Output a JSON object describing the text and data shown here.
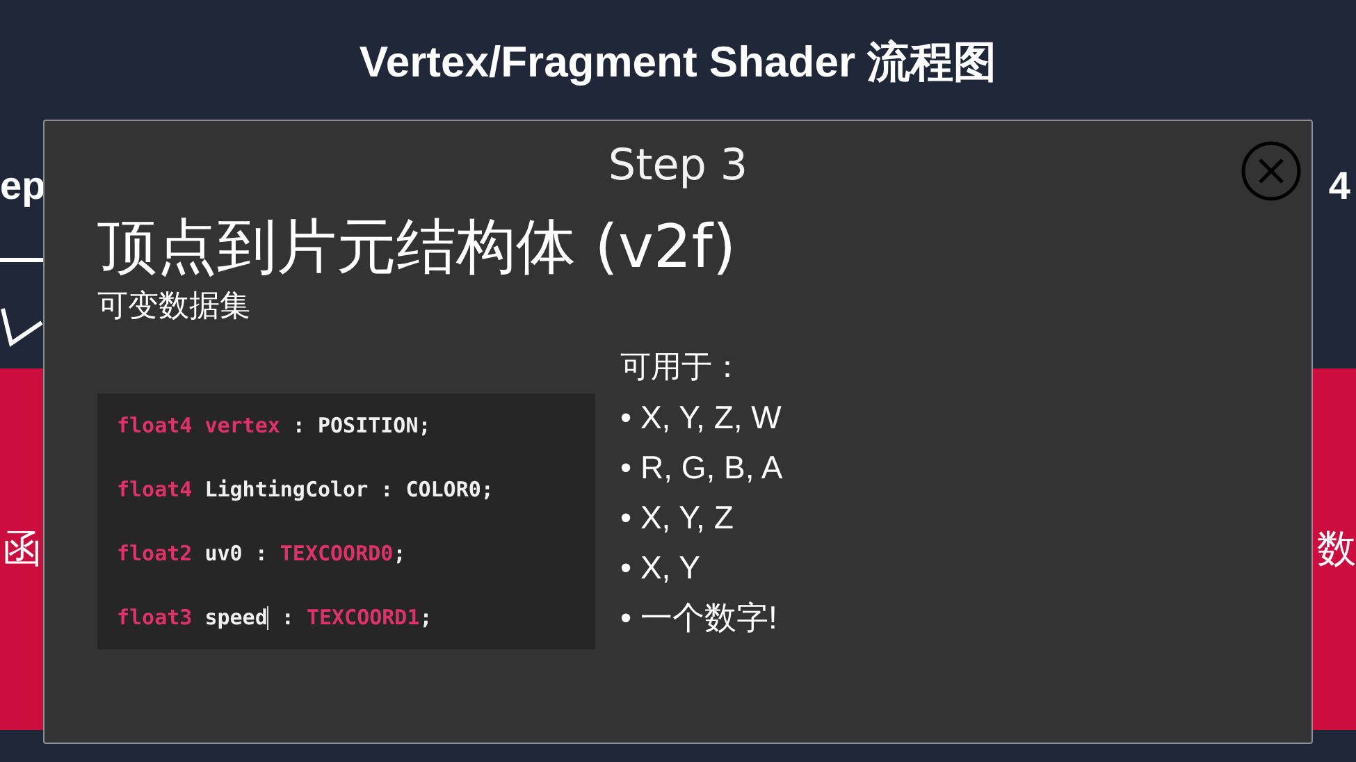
{
  "page": {
    "title": "Vertex/Fragment Shader 流程图",
    "left_step_fragment": "ep",
    "left_band_fragment": "函",
    "right_step_fragment": "4",
    "right_band_fragment": "数"
  },
  "modal": {
    "step": "Step 3",
    "heading": "顶点到片元结构体 (v2f)",
    "subheading": "可变数据集",
    "code_lines": [
      {
        "tokens": [
          {
            "text": "float4",
            "kind": "accent"
          },
          {
            "text": " vertex",
            "kind": "accent"
          },
          {
            "text": " : POSITION;",
            "kind": "plain"
          }
        ]
      },
      {
        "tokens": [
          {
            "text": "float4",
            "kind": "accent"
          },
          {
            "text": " LightingColor : COLOR0;",
            "kind": "plain"
          }
        ]
      },
      {
        "tokens": [
          {
            "text": "float2",
            "kind": "accent"
          },
          {
            "text": " uv0 : ",
            "kind": "plain"
          },
          {
            "text": "TEXCOORD0",
            "kind": "accent"
          },
          {
            "text": ";",
            "kind": "plain"
          }
        ]
      },
      {
        "tokens": [
          {
            "text": "float3",
            "kind": "accent"
          },
          {
            "text": " speed",
            "kind": "plain",
            "caret": true
          },
          {
            "text": " : ",
            "kind": "plain"
          },
          {
            "text": "TEXCOORD1",
            "kind": "accent"
          },
          {
            "text": ";",
            "kind": "plain"
          }
        ]
      }
    ],
    "usage_title": "可用于：",
    "usage_items": [
      {
        "bullet": "•",
        "text": "X, Y, Z, W"
      },
      {
        "bullet": "•",
        "text": "R, G, B, A"
      },
      {
        "bullet": "•",
        "text": "X, Y, Z"
      },
      {
        "bullet": "•",
        "text": "X, Y"
      },
      {
        "bullet": "•",
        "text": "一个数字!"
      }
    ]
  }
}
